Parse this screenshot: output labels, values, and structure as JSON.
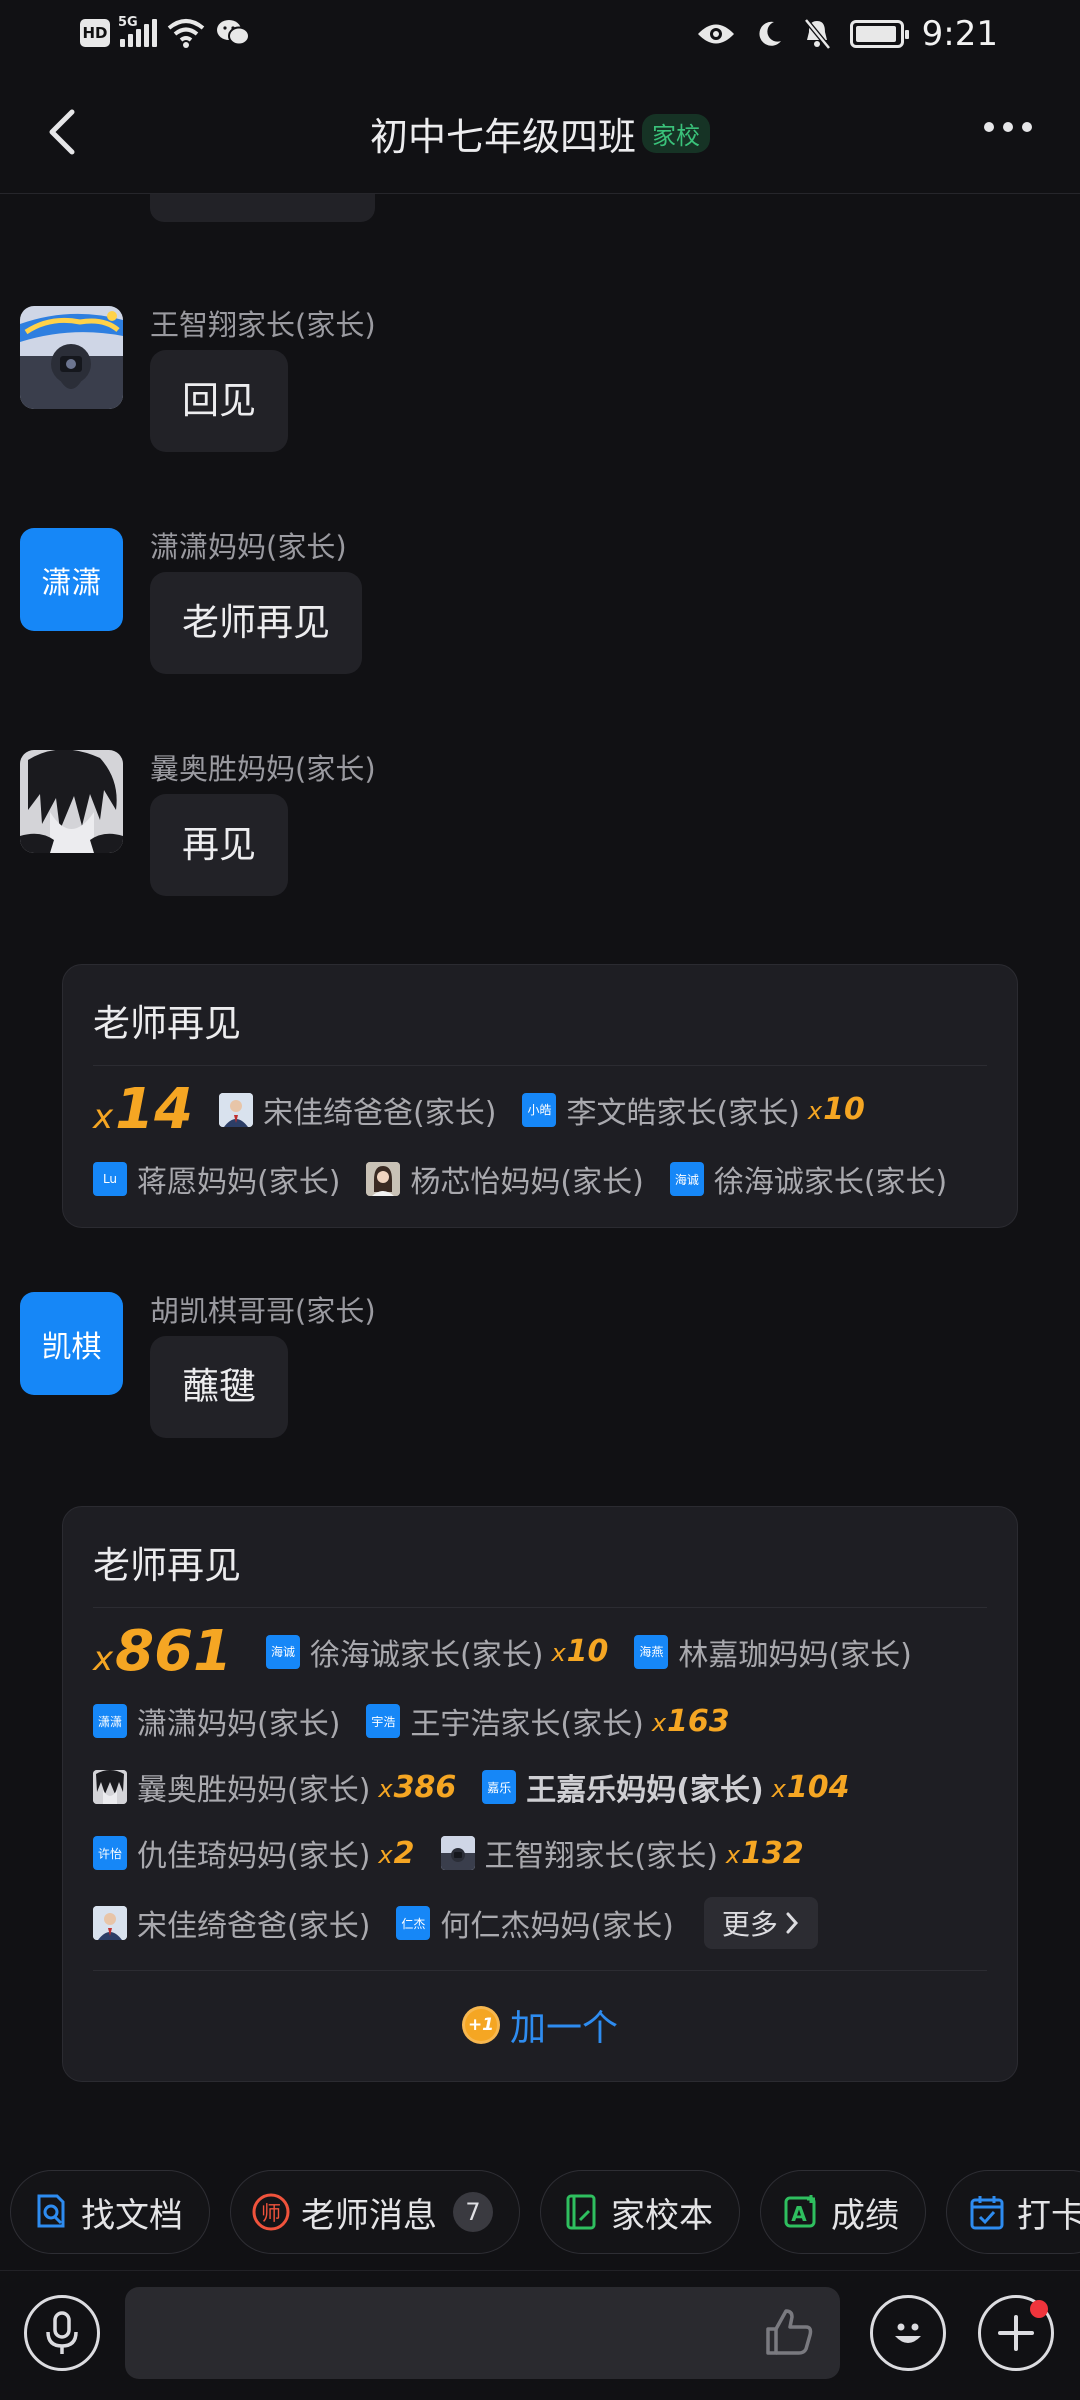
{
  "status_bar": {
    "time": "9:21",
    "hd": "HD",
    "network": "5G"
  },
  "header": {
    "title": "初中七年级四班",
    "tag": "家校"
  },
  "messages": [
    {
      "sender": "王智翔家长(家长)",
      "text": "回见",
      "avatar": "photo-sticker"
    },
    {
      "sender": "潇潇妈妈(家长)",
      "text": "老师再见",
      "avatar_text": "潇潇"
    },
    {
      "sender": "曩奥胜妈妈(家长)",
      "text": "再见",
      "avatar": "anime-photo"
    },
    {
      "sender": "胡凯棋哥哥(家长)",
      "text": "蘸毽",
      "avatar_text": "凯棋"
    }
  ],
  "cards": [
    {
      "title": "老师再见",
      "total_prefix": "x",
      "total": "14",
      "rows": [
        [
          {
            "icon": "photo",
            "name": "宋佳绮爸爸(家长)",
            "mult": ""
          },
          {
            "icon": "text",
            "icon_text": "小皓",
            "name": "李文皓家长(家长)",
            "mult": "10"
          }
        ],
        [
          {
            "icon": "text",
            "icon_text": "Lu",
            "name": "蒋愿妈妈(家长)",
            "mult": ""
          },
          {
            "icon": "photo",
            "name": "杨芯怡妈妈(家长)",
            "mult": ""
          },
          {
            "icon": "text",
            "icon_text": "海诚",
            "name": "徐海诚家长(家长)",
            "mult": ""
          }
        ]
      ]
    },
    {
      "title": "老师再见",
      "total_prefix": "x",
      "total": "861",
      "rows": [
        [
          {
            "icon": "text",
            "icon_text": "海诚",
            "name": "徐海诚家长(家长)",
            "mult": "10"
          },
          {
            "icon": "text",
            "icon_text": "海燕",
            "name": "林嘉珈妈妈(家长)",
            "mult": ""
          }
        ],
        [
          {
            "icon": "text",
            "icon_text": "潇潇",
            "name": "潇潇妈妈(家长)",
            "mult": ""
          },
          {
            "icon": "text",
            "icon_text": "宇浩",
            "name": "王宇浩家长(家长)",
            "mult": "163"
          }
        ],
        [
          {
            "icon": "photo",
            "name": "曩奥胜妈妈(家长)",
            "mult": "386"
          },
          {
            "icon": "text",
            "icon_text": "嘉乐",
            "name": "王嘉乐妈妈(家长)",
            "mult": "104",
            "bold": true
          }
        ],
        [
          {
            "icon": "text",
            "icon_text": "许怡",
            "name": "仇佳琦妈妈(家长)",
            "mult": "2"
          },
          {
            "icon": "photo",
            "name": "王智翔家长(家长)",
            "mult": "132"
          }
        ],
        [
          {
            "icon": "photo",
            "name": "宋佳绮爸爸(家长)",
            "mult": ""
          },
          {
            "icon": "text",
            "icon_text": "仁杰",
            "name": "何仁杰妈妈(家长)",
            "mult": ""
          }
        ]
      ],
      "more_label": "更多",
      "add_label": "加一个",
      "add_icon_text": "+1"
    }
  ],
  "chips": [
    {
      "label": "找文档",
      "icon": "search-doc-icon",
      "color": "#2e8cf0"
    },
    {
      "label": "老师消息",
      "icon": "teacher-icon",
      "color": "#f0533c",
      "badge": "7"
    },
    {
      "label": "家校本",
      "icon": "notebook-icon",
      "color": "#2fbf5f"
    },
    {
      "label": "成绩",
      "icon": "grade-icon",
      "color": "#2fbf5f"
    },
    {
      "label": "打卡",
      "icon": "checkin-icon",
      "color": "#2e8cf0"
    }
  ],
  "input_bar": {
    "placeholder": ""
  },
  "colors": {
    "accent_orange": "#f5a623",
    "accent_blue": "#2e8cf0",
    "avatar_blue": "#1687f7",
    "tag_green": "#3ac27a"
  }
}
